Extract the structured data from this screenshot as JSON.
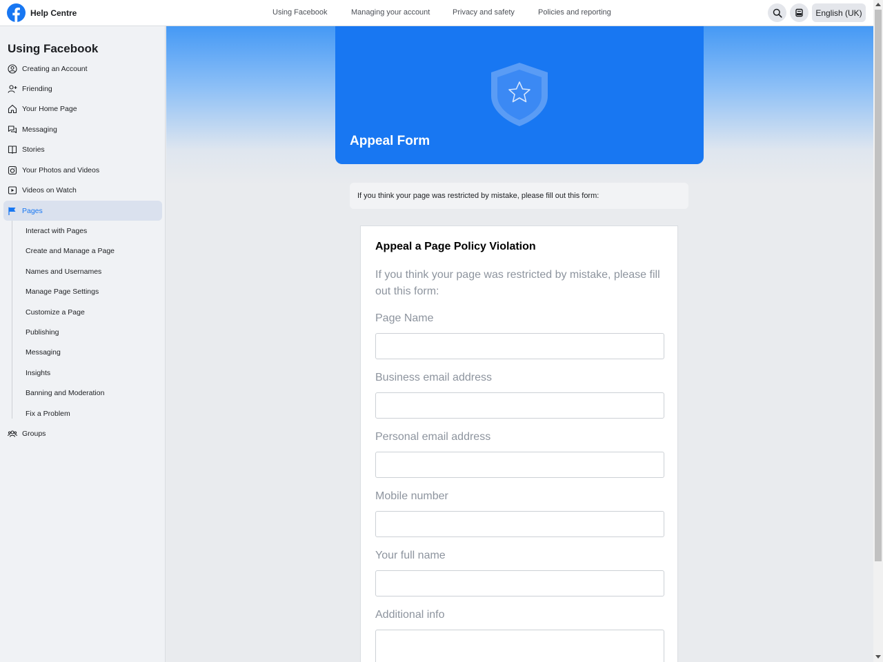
{
  "header": {
    "brand": "Help Centre",
    "nav": [
      "Using Facebook",
      "Managing your account",
      "Privacy and safety",
      "Policies and reporting"
    ],
    "language": "English (UK)"
  },
  "sidebar": {
    "title": "Using Facebook",
    "items": [
      {
        "label": "Creating an Account",
        "icon": "user-circle-icon"
      },
      {
        "label": "Friending",
        "icon": "add-friend-icon"
      },
      {
        "label": "Your Home Page",
        "icon": "home-icon"
      },
      {
        "label": "Messaging",
        "icon": "chat-bubbles-icon"
      },
      {
        "label": "Stories",
        "icon": "book-icon"
      },
      {
        "label": "Your Photos and Videos",
        "icon": "camera-icon"
      },
      {
        "label": "Videos on Watch",
        "icon": "play-icon"
      },
      {
        "label": "Pages",
        "icon": "flag-icon",
        "active": true
      }
    ],
    "subitems": [
      "Interact with Pages",
      "Create and Manage a Page",
      "Names and Usernames",
      "Manage Page Settings",
      "Customize a Page",
      "Publishing",
      "Messaging",
      "Insights",
      "Banning and Moderation",
      "Fix a Problem"
    ],
    "groups": {
      "label": "Groups",
      "icon": "groups-icon"
    }
  },
  "hero": {
    "title": "Appeal Form"
  },
  "notice": "If you think your page was restricted by mistake, please fill out this form:",
  "form": {
    "title": "Appeal a Page Policy Violation",
    "description": "If you think your page was restricted by mistake, please fill out this form:",
    "fields": [
      {
        "label": "Page Name",
        "value": ""
      },
      {
        "label": "Business email address",
        "value": ""
      },
      {
        "label": "Personal email address",
        "value": ""
      },
      {
        "label": "Mobile number",
        "value": ""
      },
      {
        "label": "Your full name",
        "value": ""
      },
      {
        "label": "Additional info",
        "value": ""
      }
    ]
  },
  "colors": {
    "accent": "#1877f2",
    "sidebar_bg": "#f0f2f5",
    "active_bg": "#dae1ee"
  }
}
